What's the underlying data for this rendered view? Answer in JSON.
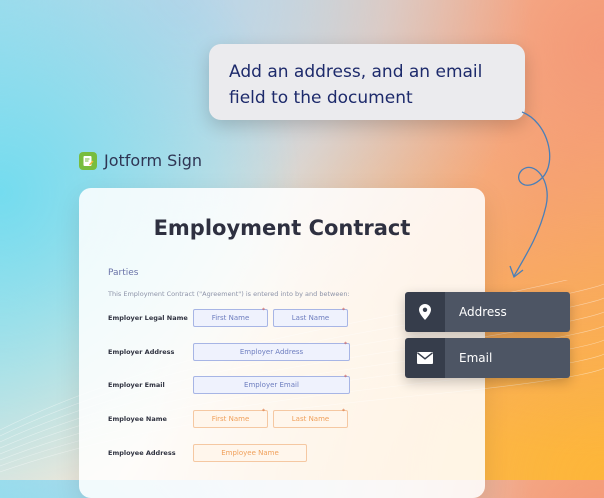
{
  "prompt": {
    "line1": "Add an address, and an email",
    "line2": "field to the document"
  },
  "brand": {
    "name": "Jotform Sign",
    "logo_icon": "edit-document-icon",
    "logo_color": "#78bd3f"
  },
  "document": {
    "title": "Employment Contract",
    "section": "Parties",
    "intro": "This Employment Contract (\"Agreement\") is entered into by and between:",
    "rows": {
      "employer_name": {
        "label": "Employer Legal Name",
        "first": "First Name",
        "last": "Last Name"
      },
      "employer_address": {
        "label": "Employer Address",
        "field": "Employer Address"
      },
      "employer_email": {
        "label": "Employer Email",
        "field": "Employer Email"
      },
      "employee_name": {
        "label": "Employee Name",
        "first": "First Name",
        "last": "Last Name"
      },
      "employee_address": {
        "label": "Employee Address",
        "field": "Employee Name"
      }
    },
    "required_mark": "*"
  },
  "field_buttons": {
    "address": {
      "label": "Address",
      "icon": "map-pin-icon"
    },
    "email": {
      "label": "Email",
      "icon": "envelope-icon"
    }
  },
  "colors": {
    "prompt_text": "#1d2a6b",
    "employer_field": "#6d7dbf",
    "employee_field": "#f0a05b",
    "button_dark": "#363d4b",
    "button_label_bg": "#4d5564"
  }
}
